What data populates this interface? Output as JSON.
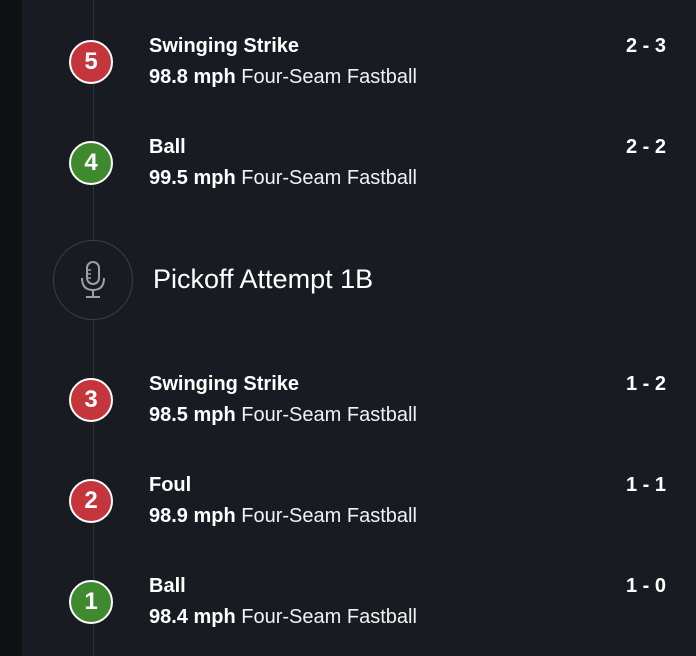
{
  "pitches": [
    {
      "number": "5",
      "result": "Swinging Strike",
      "speed": "98.8 mph",
      "type": "Four-Seam Fastball",
      "count": "2 - 3",
      "status": "strike",
      "badge_color": "#c4363b"
    },
    {
      "number": "4",
      "result": "Ball",
      "speed": "99.5 mph",
      "type": "Four-Seam Fastball",
      "count": "2 - 2",
      "status": "ball",
      "badge_color": "#3f8a2f"
    },
    {
      "number": "3",
      "result": "Swinging Strike",
      "speed": "98.5 mph",
      "type": "Four-Seam Fastball",
      "count": "1 - 2",
      "status": "strike",
      "badge_color": "#c4363b"
    },
    {
      "number": "2",
      "result": "Foul",
      "speed": "98.9 mph",
      "type": "Four-Seam Fastball",
      "count": "1 - 1",
      "status": "strike",
      "badge_color": "#c4363b"
    },
    {
      "number": "1",
      "result": "Ball",
      "speed": "98.4 mph",
      "type": "Four-Seam Fastball",
      "count": "1 - 0",
      "status": "ball",
      "badge_color": "#3f8a2f"
    }
  ],
  "event": {
    "label": "Pickoff Attempt 1B",
    "icon": "microphone-icon"
  }
}
